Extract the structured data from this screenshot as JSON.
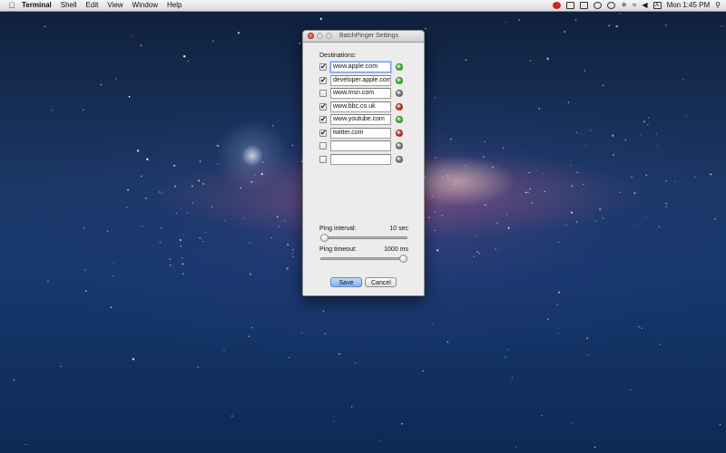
{
  "menubar": {
    "app_name": "Terminal",
    "items": [
      "Shell",
      "Edit",
      "View",
      "Window",
      "Help"
    ],
    "clock": "Mon 1:45 PM",
    "tray_icons": [
      "red-record-icon",
      "screen-icon",
      "battery-icon",
      "lifesaver-icon",
      "clock-icon",
      "bluetooth-icon",
      "wifi-icon",
      "volume-icon",
      "text-input-icon"
    ]
  },
  "window": {
    "title": "BatchPinger Settings",
    "destinations_label": "Destinations:",
    "destinations": [
      {
        "checked": true,
        "host": "www.apple.com",
        "status": "green",
        "focused": true
      },
      {
        "checked": true,
        "host": "developer.apple.com",
        "status": "green",
        "focused": false
      },
      {
        "checked": false,
        "host": "www.msn.com",
        "status": "gray",
        "focused": false
      },
      {
        "checked": true,
        "host": "www.bbc.co.uk",
        "status": "red",
        "focused": false
      },
      {
        "checked": true,
        "host": "www.youtube.com",
        "status": "green",
        "focused": false
      },
      {
        "checked": true,
        "host": "twitter.com",
        "status": "red",
        "focused": false
      },
      {
        "checked": false,
        "host": "",
        "status": "gray",
        "focused": false
      },
      {
        "checked": false,
        "host": "",
        "status": "gray",
        "focused": false
      }
    ],
    "ping_interval": {
      "label": "Ping interval:",
      "value": "10 sec",
      "fraction": 0.0
    },
    "ping_timeout": {
      "label": "Ping timeout:",
      "value": "1000 ms",
      "fraction": 1.0
    },
    "save_label": "Save",
    "cancel_label": "Cancel"
  },
  "colors": {
    "green": "#35b82c",
    "red": "#d22a22",
    "gray": "#7a7a7a",
    "focus": "#6d9ee8"
  }
}
